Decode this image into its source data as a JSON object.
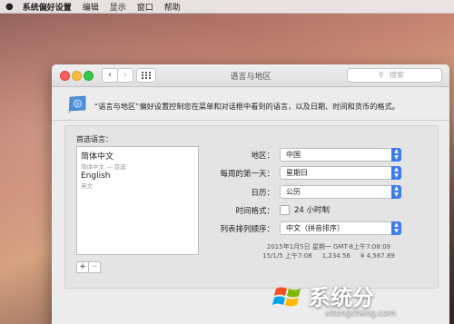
{
  "menubar": {
    "apple": "",
    "app_name": "系统偏好设置",
    "items": [
      "编辑",
      "显示",
      "窗口",
      "帮助"
    ]
  },
  "window": {
    "title": "语言与地区",
    "search_placeholder": "搜索"
  },
  "header": {
    "description": "“语言与地区”偏好设置控制您在菜单和对话框中看到的语言，以及日期、时间和货币的格式。"
  },
  "languages": {
    "label": "首选语言：",
    "items": [
      {
        "name": "简体中文",
        "sub": "简体中文 — 首选"
      },
      {
        "name": "English",
        "sub": "英文"
      }
    ],
    "add_label": "+",
    "remove_label": "−"
  },
  "settings": {
    "region_label": "地区：",
    "region_value": "中国",
    "first_day_label": "每周的第一天：",
    "first_day_value": "星期日",
    "calendar_label": "日历：",
    "calendar_value": "公历",
    "time_format_label": "时间格式：",
    "time_format_check": "24 小时制",
    "sort_label": "列表排列顺序：",
    "sort_value": "中文（拼音排序）"
  },
  "sample": {
    "line1": "2015年1月5日 星期一 GMT-8上午7:08:09",
    "line2": "15/1/5 上午7:08     1,234.56     ¥ 4,567.89"
  },
  "watermark": {
    "text": "系统分",
    "url": "xitongcheng.com"
  },
  "colors": {
    "accent": "#3d7cf0",
    "close": "#fc605b",
    "minimize": "#fdbc40",
    "zoom": "#34c84a"
  }
}
